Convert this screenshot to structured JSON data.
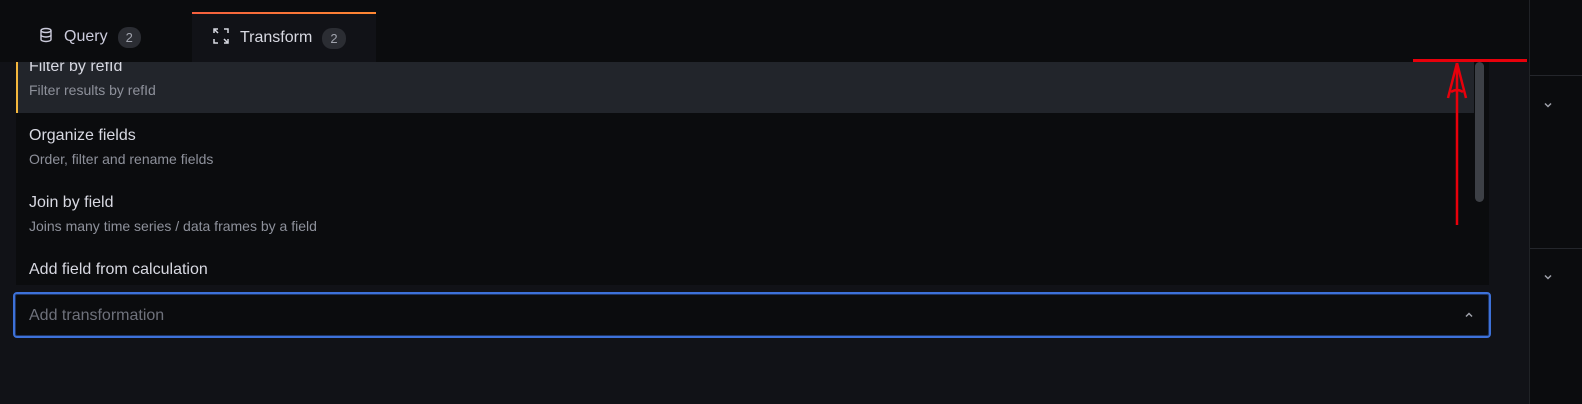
{
  "tabs": [
    {
      "label": "Query",
      "count": "2",
      "icon": "database-icon"
    },
    {
      "label": "Transform",
      "count": "2",
      "icon": "transform-icon"
    }
  ],
  "dropdown": {
    "options": [
      {
        "title": "Filter by refId",
        "description": "Filter results by refId"
      },
      {
        "title": "Organize fields",
        "description": "Order, filter and rename fields"
      },
      {
        "title": "Join by field",
        "description": "Joins many time series / data frames by a field"
      },
      {
        "title": "Add field from calculation",
        "description": ""
      }
    ]
  },
  "search": {
    "placeholder": "Add transformation",
    "value": ""
  },
  "colors": {
    "accent": "#3d71d9",
    "active_tab_border": "#f55f3e",
    "annotation": "#e8000b"
  }
}
